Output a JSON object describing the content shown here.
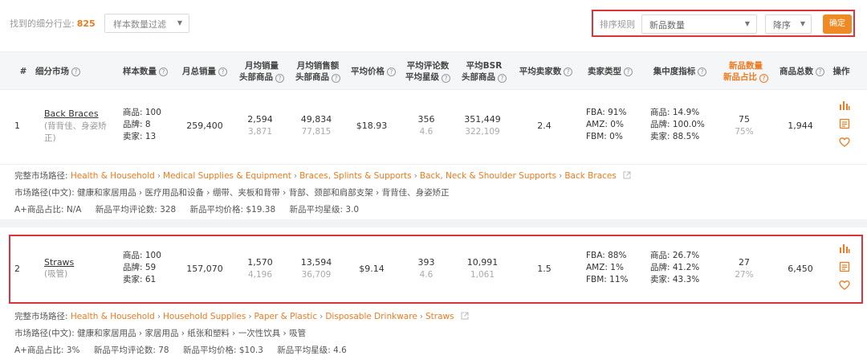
{
  "toolbar": {
    "found_label": "找到的细分行业:",
    "found_count": "825",
    "sample_filter": "样本数量过滤",
    "sort_rule_label": "排序规则",
    "sort_field": "新品数量",
    "sort_order": "降序",
    "confirm": "确定"
  },
  "columns": {
    "idx": "#",
    "market": "细分市场",
    "sample": "样本数量",
    "monthly_sales": "月总销量",
    "avg_sales_top_1": "月均销量",
    "avg_sales_top_2": "头部商品",
    "avg_revenue_top_1": "月均销售额",
    "avg_revenue_top_2": "头部商品",
    "avg_price": "平均价格",
    "avg_reviews_1": "平均评论数",
    "avg_reviews_2": "平均星级",
    "avg_bsr_1": "平均BSR",
    "avg_bsr_2": "头部商品",
    "avg_sellers": "平均卖家数",
    "seller_type": "卖家类型",
    "concentration": "集中度指标",
    "new_count_1": "新品数量",
    "new_count_2": "新品占比",
    "total_products": "商品总数",
    "actions": "操作"
  },
  "rows": [
    {
      "idx": "1",
      "name": "Back Braces",
      "name_cn_1": "(背背佳、身姿矫",
      "name_cn_2": "正)",
      "sample_products": "商品: 100",
      "sample_brands": "品牌: 8",
      "sample_sellers": "卖家: 13",
      "monthly_sales": "259,400",
      "avg_sales_top": "2,594",
      "avg_sales_top_sub": "3,871",
      "avg_revenue_top": "49,834",
      "avg_revenue_top_sub": "77,815",
      "avg_price": "$18.93",
      "avg_reviews": "356",
      "avg_rating": "4.6",
      "avg_bsr": "351,449",
      "avg_bsr_top": "322,109",
      "avg_sellers": "2.4",
      "fba": "FBA: 91%",
      "amz": "AMZ: 0%",
      "fbm": "FBM: 0%",
      "conc_products": "商品: 14.9%",
      "conc_brands": "品牌: 100.0%",
      "conc_sellers": "卖家: 88.5%",
      "new_count": "75",
      "new_ratio": "75%",
      "total_products": "1,944",
      "path_label": "完整市场路径:",
      "path": [
        "Health & Household",
        "Medical Supplies & Equipment",
        "Braces, Splints & Supports",
        "Back, Neck & Shoulder Supports",
        "Back Braces"
      ],
      "path_cn": "市场路径(中文): 健康和家居用品 › 医疗用品和设备 › 绷带、夹板和背带 › 背部、颈部和肩部支架 › 背背佳、身姿矫正",
      "aplus": "A+商品占比: N/A",
      "new_avg_reviews": "新品平均评论数: 328",
      "new_avg_price": "新品平均价格: $19.38",
      "new_avg_rating": "新品平均星级: 3.0"
    },
    {
      "idx": "2",
      "name": "Straws",
      "name_cn_1": "(吸管)",
      "name_cn_2": "",
      "sample_products": "商品: 100",
      "sample_brands": "品牌: 59",
      "sample_sellers": "卖家: 61",
      "monthly_sales": "157,070",
      "avg_sales_top": "1,570",
      "avg_sales_top_sub": "4,196",
      "avg_revenue_top": "13,594",
      "avg_revenue_top_sub": "36,709",
      "avg_price": "$9.14",
      "avg_reviews": "393",
      "avg_rating": "4.6",
      "avg_bsr": "10,991",
      "avg_bsr_top": "1,061",
      "avg_sellers": "1.5",
      "fba": "FBA: 88%",
      "amz": "AMZ: 1%",
      "fbm": "FBM: 11%",
      "conc_products": "商品: 26.7%",
      "conc_brands": "品牌: 41.2%",
      "conc_sellers": "卖家: 43.3%",
      "new_count": "27",
      "new_ratio": "27%",
      "total_products": "6,450",
      "path_label": "完整市场路径:",
      "path": [
        "Health & Household",
        "Household Supplies",
        "Paper & Plastic",
        "Disposable Drinkware",
        "Straws"
      ],
      "path_cn": "市场路径(中文): 健康和家居用品 › 家居用品 › 纸张和塑料 › 一次性饮具 › 吸管",
      "aplus": "A+商品占比: 3%",
      "new_avg_reviews": "新品平均评论数: 78",
      "new_avg_price": "新品平均价格: $10.3",
      "new_avg_rating": "新品平均星级: 4.6"
    }
  ],
  "colors": {
    "accent": "#ee7a1f",
    "highlight": "#d9353b"
  },
  "icons": [
    "chart-icon",
    "list-icon",
    "heart-icon",
    "external-link-icon",
    "help-icon",
    "caret-down-icon"
  ]
}
